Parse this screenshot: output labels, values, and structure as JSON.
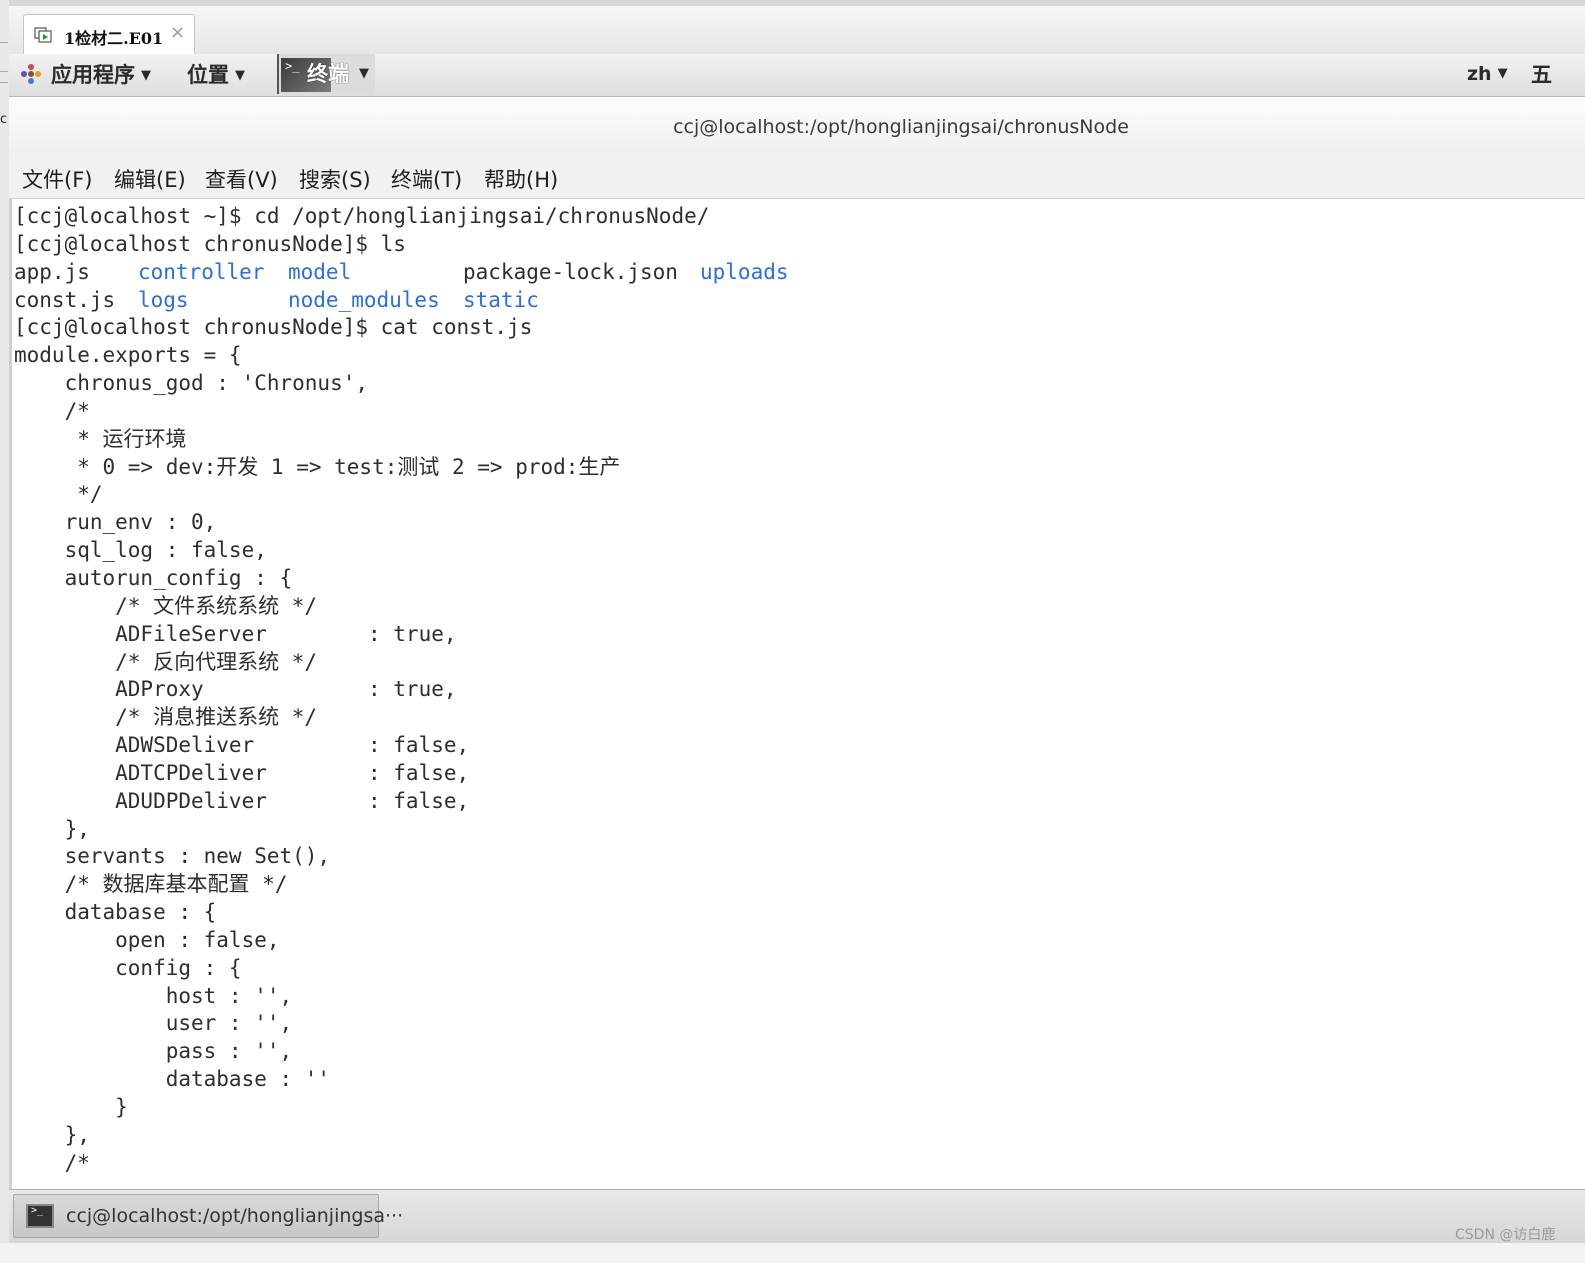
{
  "vm_tab": {
    "label": "1检材二.E01",
    "close": "×"
  },
  "panel": {
    "applications": "应用程序",
    "places": "位置",
    "terminal": "终端",
    "input_method": "zh",
    "clock_partial": "五"
  },
  "terminal": {
    "title": "ccj@localhost:/opt/honglianjingsai/chronusNode",
    "menu": [
      "文件(F)",
      "编辑(E)",
      "查看(V)",
      "搜索(S)",
      "终端(T)",
      "帮助(H)"
    ],
    "lines_before_ls": [
      "[ccj@localhost ~]$ cd /opt/honglianjingsai/chronusNode/",
      "[ccj@localhost chronusNode]$ ls"
    ],
    "ls_output": [
      [
        "app.js",
        "controller",
        "model",
        "package-lock.json",
        "uploads"
      ],
      [
        "const.js",
        "logs",
        "node_modules",
        "static",
        ""
      ]
    ],
    "ls_dirs": [
      "controller",
      "model",
      "uploads",
      "logs",
      "node_modules",
      "static"
    ],
    "lines_after_ls": [
      "[ccj@localhost chronusNode]$ cat const.js",
      "module.exports = {",
      "    chronus_god : 'Chronus',",
      "    /*",
      "     * 运行环境",
      "     * 0 => dev:开发 1 => test:测试 2 => prod:生产",
      "     */",
      "    run_env : 0,",
      "    sql_log : false,",
      "    autorun_config : {",
      "        /* 文件系统系统 */",
      "        ADFileServer        : true,",
      "        /* 反向代理系统 */",
      "        ADProxy             : true,",
      "        /* 消息推送系统 */",
      "        ADWSDeliver         : false,",
      "        ADTCPDeliver        : false,",
      "        ADUDPDeliver        : false,",
      "    },",
      "    servants : new Set(),",
      "    /* 数据库基本配置 */",
      "    database : {",
      "        open : false,",
      "        config : {",
      "            host : '',",
      "            user : '',",
      "            pass : '',",
      "            database : ''",
      "        }",
      "    },",
      "    /*"
    ]
  },
  "taskbar": {
    "item": "ccj@localhost:/opt/honglianjingsa···"
  },
  "watermark": "CSDN @访白鹿",
  "colors": {
    "directory": "#2a6ee0",
    "text": "#2e2e2e"
  }
}
